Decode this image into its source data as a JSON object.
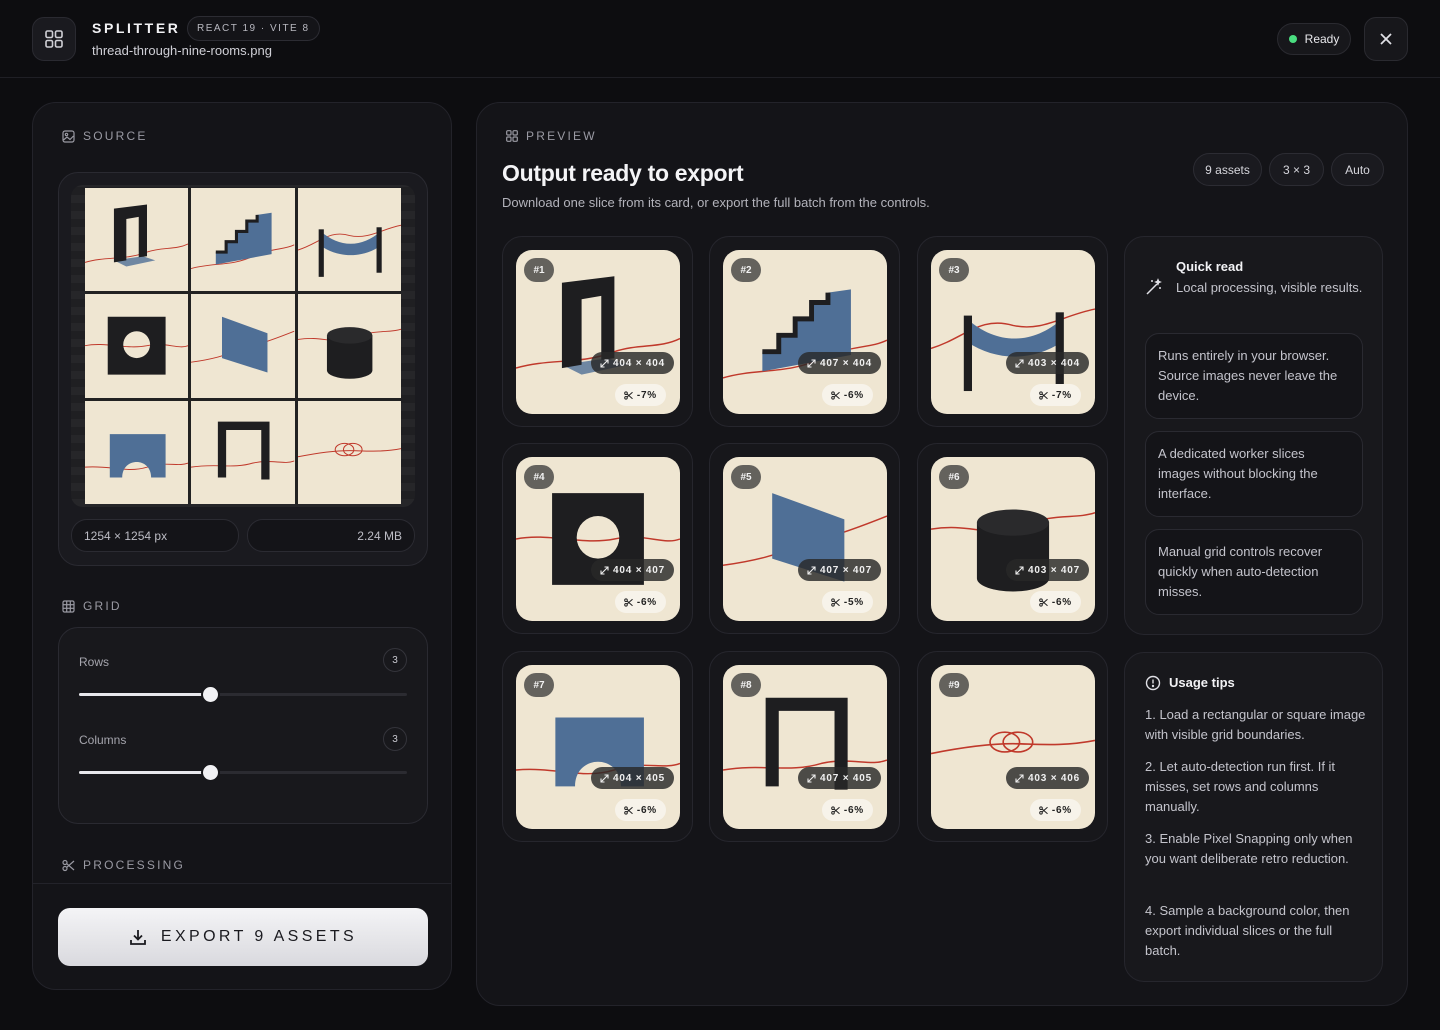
{
  "header": {
    "brand": "SPLITTER",
    "tech_badge": "REACT 19 · VITE 8",
    "filename": "thread-through-nine-rooms.png",
    "status": "Ready",
    "status_color": "#4ade80",
    "icons": {
      "app": "grid-icon",
      "close": "close-icon"
    }
  },
  "source": {
    "label": "SOURCE",
    "dimensions": "1254 × 1254 px",
    "file_size": "2.24 MB"
  },
  "grid": {
    "label": "GRID",
    "rows_label": "Rows",
    "rows_value": "3",
    "rows_level": 0.4,
    "columns_label": "Columns",
    "columns_value": "3",
    "columns_level": 0.4
  },
  "processing": {
    "label": "PROCESSING",
    "export_label": "EXPORT 9 ASSETS"
  },
  "preview": {
    "label": "PREVIEW",
    "title": "Output ready to export",
    "subtitle": "Download one slice from its card, or export the full batch from the controls.",
    "chips": [
      "9 assets",
      "3 × 3",
      "Auto"
    ],
    "tiles": [
      {
        "num": "#1",
        "dim": "404 × 404",
        "trim": "-7%"
      },
      {
        "num": "#2",
        "dim": "407 × 404",
        "trim": "-6%"
      },
      {
        "num": "#3",
        "dim": "403 × 404",
        "trim": "-7%"
      },
      {
        "num": "#4",
        "dim": "404 × 407",
        "trim": "-6%"
      },
      {
        "num": "#5",
        "dim": "407 × 407",
        "trim": "-5%"
      },
      {
        "num": "#6",
        "dim": "403 × 407",
        "trim": "-6%"
      },
      {
        "num": "#7",
        "dim": "404 × 405",
        "trim": "-6%"
      },
      {
        "num": "#8",
        "dim": "407 × 405",
        "trim": "-6%"
      },
      {
        "num": "#9",
        "dim": "403 × 406",
        "trim": "-6%"
      }
    ]
  },
  "quick_read": {
    "title": "Quick read",
    "subtitle": "Local processing, visible results.",
    "items": [
      "Runs entirely in your browser. Source images never leave the device.",
      "A dedicated worker slices images without blocking the interface.",
      "Manual grid controls recover quickly when auto-detection misses."
    ]
  },
  "tips": {
    "title": "Usage tips",
    "items": [
      "1. Load a rectangular or square image with visible grid boundaries.",
      "2. Let auto-detection run first. If it misses, set rows and columns manually.",
      "3. Enable Pixel Snapping only when you want deliberate retro reduction.",
      "4. Sample a background color, then export individual slices or the full batch."
    ]
  },
  "colors": {
    "accent_paper": "#efe6d2",
    "ink": "#1e1e20",
    "blue": "#4f6f96",
    "thread": "#c0392b"
  }
}
